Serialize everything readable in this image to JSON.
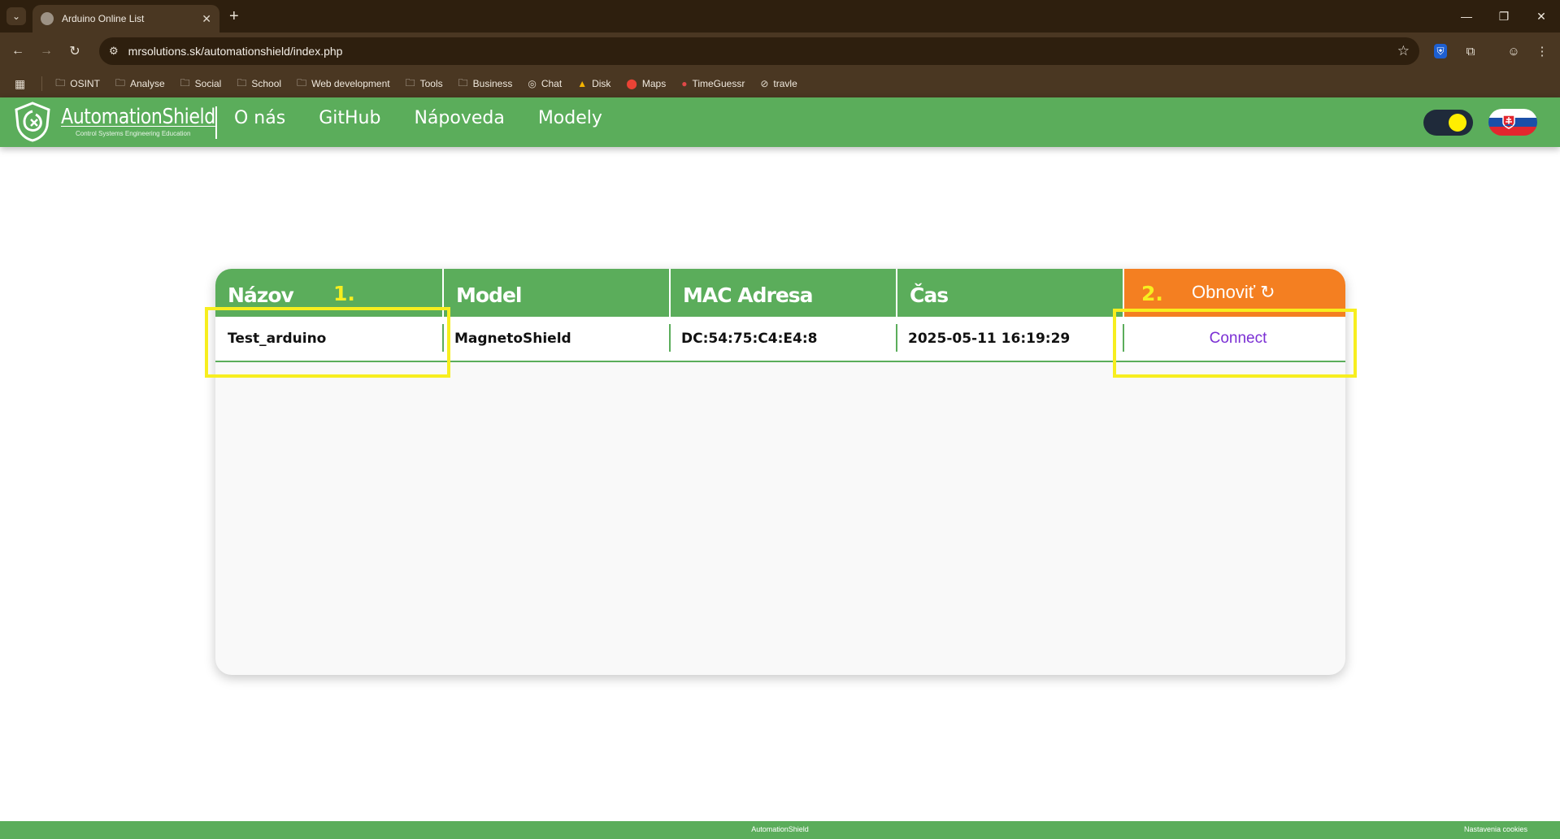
{
  "browser": {
    "tab_title": "Arduino Online List",
    "url": "mrsolutions.sk/automationshield/index.php",
    "bookmarks": [
      "OSINT",
      "Analyse",
      "Social",
      "School",
      "Web development",
      "Tools",
      "Business",
      "Chat",
      "Disk",
      "Maps",
      "TimeGuessr",
      "travle"
    ]
  },
  "site": {
    "logo_name": "AutomationShield",
    "logo_tagline": "Control Systems Engineering Education",
    "nav": [
      "O nás",
      "GitHub",
      "Nápoveda",
      "Modely"
    ],
    "accent_color": "#5bad5b",
    "refresh_color": "#f47f21",
    "theme_toggle_state": "light"
  },
  "table": {
    "headers": [
      "Názov",
      "Model",
      "MAC Adresa",
      "Čas"
    ],
    "refresh_label": "Obnoviť ↻",
    "rows": [
      {
        "name": "Test_arduino",
        "model": "MagnetoShield",
        "mac": "DC:54:75:C4:E4:8",
        "time": "2025-05-11 16:19:29",
        "action": "Connect"
      }
    ]
  },
  "annotations": {
    "label_1": "1.",
    "label_2": "2.",
    "color": "#f7ee1f"
  },
  "footer": {
    "center": "AutomationShield",
    "right": "Nastavenia cookies"
  }
}
